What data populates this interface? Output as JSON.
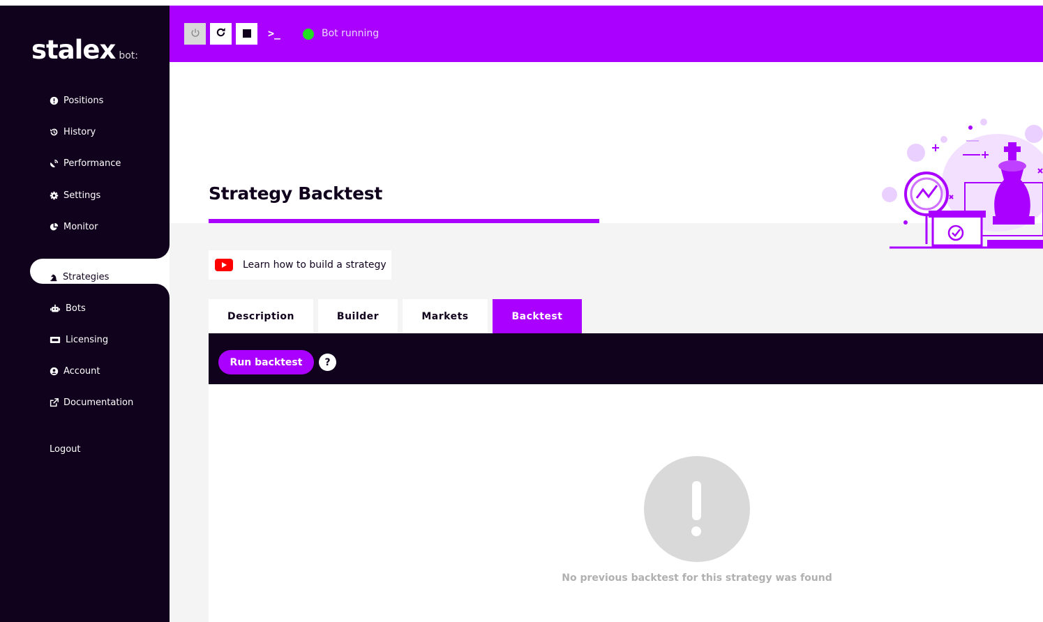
{
  "app": {
    "logo_main": "stalex",
    "logo_sub": "bot:"
  },
  "sidebar": {
    "items": [
      {
        "label": "Positions",
        "icon": "info-circle-icon"
      },
      {
        "label": "History",
        "icon": "history-icon"
      },
      {
        "label": "Performance",
        "icon": "satellite-dish-icon"
      },
      {
        "label": "Settings",
        "icon": "gear-icon"
      },
      {
        "label": "Monitor",
        "icon": "pie-chart-icon"
      },
      {
        "label": "Strategies",
        "icon": "chess-knight-icon",
        "active": true
      },
      {
        "label": "Bots",
        "icon": "robot-icon"
      },
      {
        "label": "Licensing",
        "icon": "ticket-icon"
      },
      {
        "label": "Account",
        "icon": "user-circle-icon"
      },
      {
        "label": "Documentation",
        "icon": "external-link-icon"
      }
    ],
    "logout": "Logout"
  },
  "topbar": {
    "terminal_glyph": ">_",
    "status_text": "Bot running",
    "status_color": "#22e01f"
  },
  "page": {
    "title": "Strategy Backtest",
    "learn_link": "Learn how to build a strategy"
  },
  "tabs": [
    {
      "label": "Description"
    },
    {
      "label": "Builder"
    },
    {
      "label": "Markets"
    },
    {
      "label": "Backtest",
      "active": true
    }
  ],
  "toolbar": {
    "run_label": "Run backtest",
    "help_label": "?"
  },
  "empty_state": {
    "message": "No previous backtest for this strategy was found"
  },
  "colors": {
    "accent": "#aa00ff",
    "dark": "#10021c"
  }
}
